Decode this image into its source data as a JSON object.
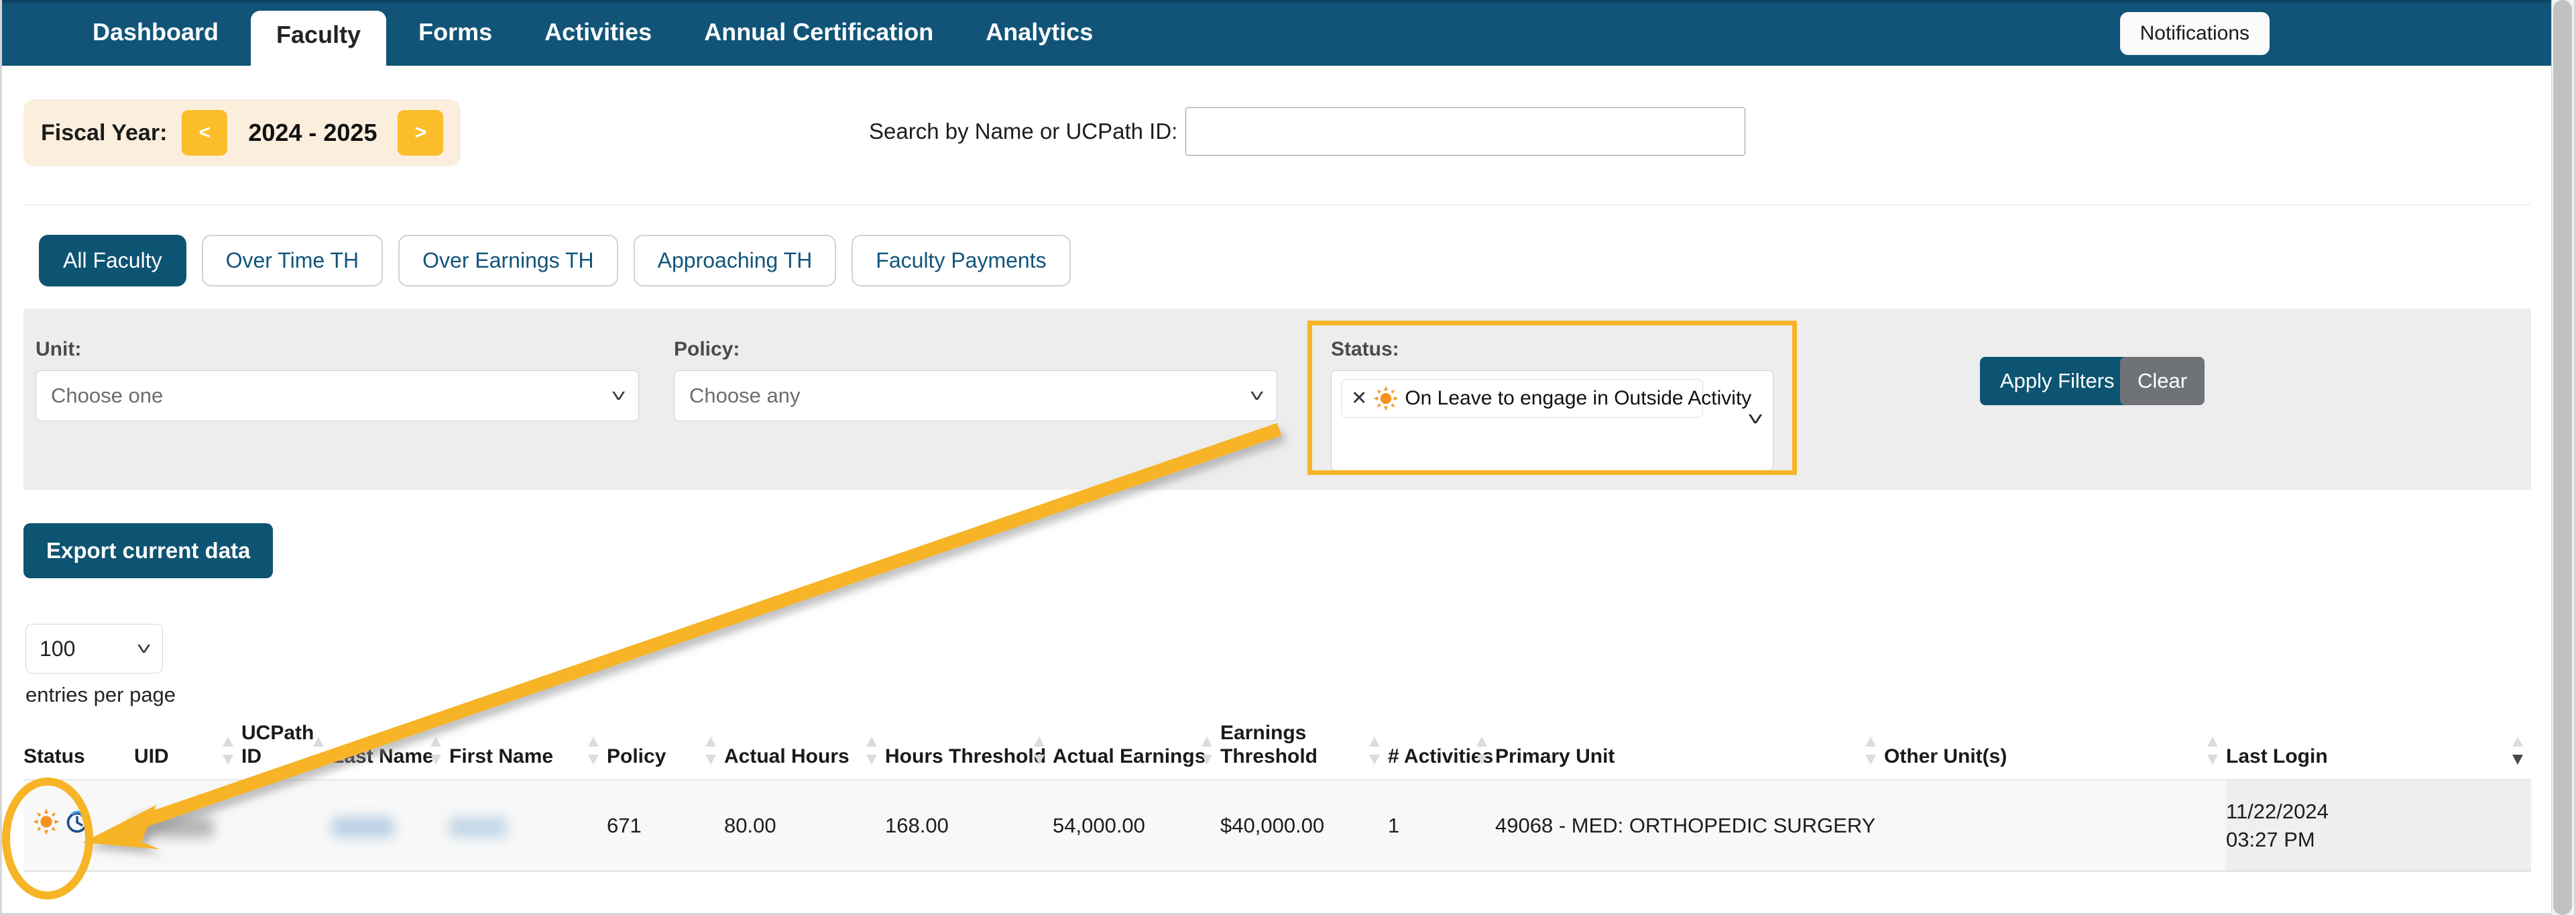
{
  "nav": {
    "tabs": [
      {
        "label": "Dashboard",
        "active": false
      },
      {
        "label": "Faculty",
        "active": true
      },
      {
        "label": "Forms",
        "active": false
      },
      {
        "label": "Activities",
        "active": false
      },
      {
        "label": "Annual Certification",
        "active": false
      },
      {
        "label": "Analytics",
        "active": false
      }
    ],
    "notifications_label": "Notifications",
    "bar_color": "#115478"
  },
  "fiscal_year": {
    "label": "Fiscal Year:",
    "prev_label": "<",
    "next_label": ">",
    "value": "2024 - 2025",
    "panel_color": "#fbeedc",
    "arrow_color": "#fbbe2a"
  },
  "search": {
    "label": "Search by Name or UCPath ID:",
    "value": "",
    "placeholder": ""
  },
  "segments": [
    {
      "label": "All Faculty",
      "active": true
    },
    {
      "label": "Over Time TH",
      "active": false
    },
    {
      "label": "Over Earnings TH",
      "active": false
    },
    {
      "label": "Approaching TH",
      "active": false
    },
    {
      "label": "Faculty Payments",
      "active": false
    }
  ],
  "filters": {
    "unit": {
      "label": "Unit:",
      "value": "Choose one"
    },
    "policy": {
      "label": "Policy:",
      "value": "Choose any"
    },
    "status": {
      "label": "Status:",
      "chip_label": "On Leave to engage in Outside Activity",
      "chip_remove": "✕",
      "chip_icon": "sun-icon",
      "highlight_color": "#f6b426"
    },
    "apply_label": "Apply Filters",
    "clear_label": "Clear",
    "apply_color": "#0d5472",
    "clear_color": "#6f7378"
  },
  "toolbar": {
    "export_label": "Export current data",
    "export_color": "#0d5472"
  },
  "pagination": {
    "entries_value": "100",
    "entries_caption": "entries per page"
  },
  "table": {
    "columns": [
      {
        "label": "Status",
        "sortable": false,
        "sorted": false
      },
      {
        "label": "UID",
        "sortable": true,
        "sorted": false
      },
      {
        "label": "UCPath ID",
        "sortable": true,
        "sorted": false
      },
      {
        "label": "Last Name",
        "sortable": true,
        "sorted": false
      },
      {
        "label": "First Name",
        "sortable": true,
        "sorted": false
      },
      {
        "label": "Policy",
        "sortable": true,
        "sorted": false
      },
      {
        "label": "Actual Hours",
        "sortable": true,
        "sorted": false
      },
      {
        "label": "Hours Threshold",
        "sortable": true,
        "sorted": false
      },
      {
        "label": "Actual Earnings",
        "sortable": true,
        "sorted": false
      },
      {
        "label": "Earnings Threshold",
        "sortable": true,
        "sorted": false
      },
      {
        "label": "# Activities",
        "sortable": true,
        "sorted": false
      },
      {
        "label": "Primary Unit",
        "sortable": true,
        "sorted": false
      },
      {
        "label": "Other Unit(s)",
        "sortable": true,
        "sorted": false
      },
      {
        "label": "Last Login",
        "sortable": true,
        "sorted": true
      }
    ],
    "rows": [
      {
        "status_icons": [
          "sun-icon",
          "clock-history-icon"
        ],
        "uid": "",
        "ucpath_id": "",
        "last_name": "",
        "first_name": "",
        "policy": "671",
        "actual_hours": "80.00",
        "hours_threshold": "168.00",
        "actual_earnings": "54,000.00",
        "earnings_threshold": "$40,000.00",
        "num_activities": "1",
        "primary_unit": "49068 - MED: ORTHOPEDIC SURGERY",
        "other_units": "",
        "last_login_date": "11/22/2024",
        "last_login_time": "03:27 PM"
      }
    ]
  },
  "annotation": {
    "arrow_color": "#f6b426",
    "description": "arrow from status filter to status cell icon with ellipse callout"
  }
}
